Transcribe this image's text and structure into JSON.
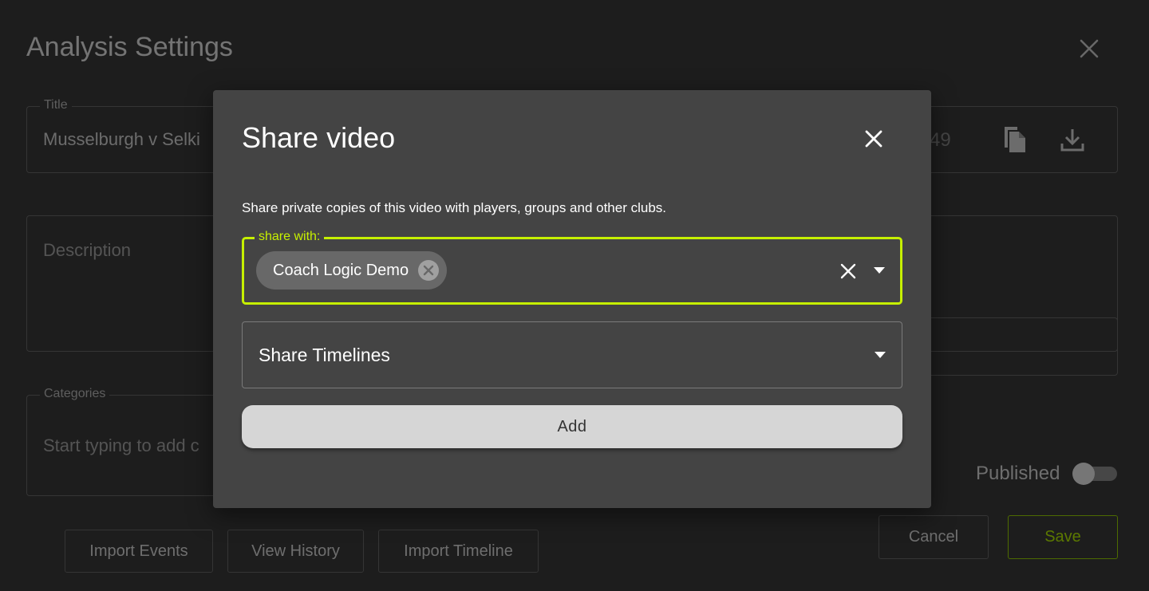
{
  "page": {
    "title": "Analysis Settings",
    "title_field": {
      "label": "Title",
      "value": "Musselburgh v Selki",
      "char_count": "49"
    },
    "description_field": {
      "placeholder": "Description"
    },
    "categories_field": {
      "label": "Categories",
      "placeholder": "Start typing to add c"
    },
    "published": {
      "label": "Published",
      "on": false
    },
    "buttons": {
      "import_events": "Import Events",
      "view_history": "View History",
      "import_timeline": "Import Timeline",
      "cancel": "Cancel",
      "save": "Save"
    },
    "icons": {
      "copy": "copy-icon",
      "download": "download-icon",
      "close": "close-icon"
    }
  },
  "modal": {
    "title": "Share video",
    "description": "Share private copies of this video with players, groups and other clubs.",
    "share_field": {
      "label": "share with:",
      "chips": [
        "Coach Logic Demo"
      ]
    },
    "timelines_field": {
      "label": "Share Timelines"
    },
    "add_button": "Add"
  },
  "colors": {
    "accent": "#c6f000",
    "modal_bg": "#444444",
    "page_bg": "#1d1d1d"
  }
}
